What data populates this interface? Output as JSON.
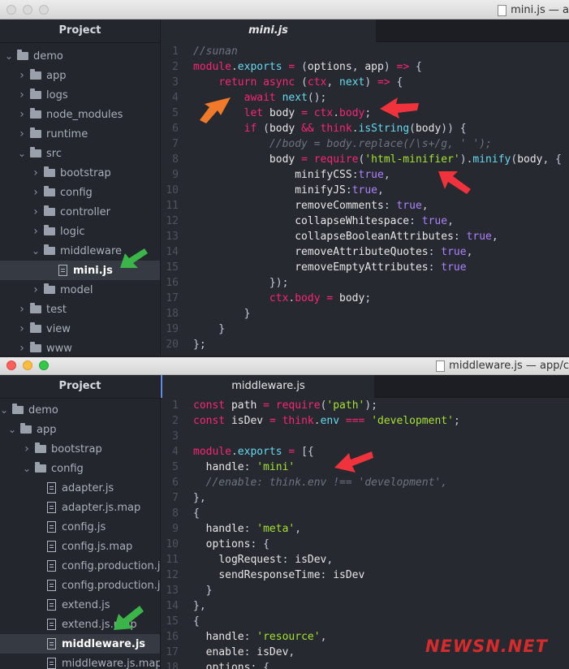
{
  "top_window": {
    "title": "mini.js — a",
    "sidebar_header": "Project",
    "tab_label": "mini.js",
    "tree": [
      {
        "label": "demo",
        "type": "folder",
        "expanded": true
      },
      {
        "label": "app",
        "type": "folder",
        "expanded": false
      },
      {
        "label": "logs",
        "type": "folder",
        "expanded": false
      },
      {
        "label": "node_modules",
        "type": "folder",
        "expanded": false
      },
      {
        "label": "runtime",
        "type": "folder",
        "expanded": false
      },
      {
        "label": "src",
        "type": "folder",
        "expanded": true
      },
      {
        "label": "bootstrap",
        "type": "folder",
        "expanded": false
      },
      {
        "label": "config",
        "type": "folder",
        "expanded": false
      },
      {
        "label": "controller",
        "type": "folder",
        "expanded": false
      },
      {
        "label": "logic",
        "type": "folder",
        "expanded": false
      },
      {
        "label": "middleware",
        "type": "folder",
        "expanded": true
      },
      {
        "label": "mini.js",
        "type": "file",
        "selected": true
      },
      {
        "label": "model",
        "type": "folder",
        "expanded": false
      },
      {
        "label": "test",
        "type": "folder",
        "expanded": false
      },
      {
        "label": "view",
        "type": "folder",
        "expanded": false
      },
      {
        "label": "www",
        "type": "folder",
        "expanded": false
      }
    ],
    "code_lines": [
      [
        "1",
        "//sunan"
      ],
      [
        "2",
        "module.exports = (options, app) => {"
      ],
      [
        "3",
        "    return async (ctx, next) => {"
      ],
      [
        "4",
        "        await next();"
      ],
      [
        "5",
        "        let body = ctx.body;"
      ],
      [
        "6",
        "        if (body && think.isString(body)) {"
      ],
      [
        "7",
        "            //body = body.replace(/\\s+/g, ' ');"
      ],
      [
        "8",
        "            body = require('html-minifier').minify(body, {"
      ],
      [
        "9",
        "                minifyCSS:true,"
      ],
      [
        "10",
        "                minifyJS:true,"
      ],
      [
        "11",
        "                removeComments: true,"
      ],
      [
        "12",
        "                collapseWhitespace: true,"
      ],
      [
        "13",
        "                collapseBooleanAttributes: true,"
      ],
      [
        "14",
        "                removeAttributeQuotes: true,"
      ],
      [
        "15",
        "                removeEmptyAttributes: true"
      ],
      [
        "16",
        "            });"
      ],
      [
        "17",
        "            ctx.body = body;"
      ],
      [
        "18",
        "        }"
      ],
      [
        "19",
        "    }"
      ],
      [
        "20",
        "};"
      ]
    ]
  },
  "bottom_window": {
    "title": "middleware.js — app/c",
    "sidebar_header": "Project",
    "tab_label": "middleware.js",
    "tree": [
      {
        "label": "demo",
        "type": "folder",
        "expanded": true
      },
      {
        "label": "app",
        "type": "folder",
        "expanded": true
      },
      {
        "label": "bootstrap",
        "type": "folder",
        "expanded": false
      },
      {
        "label": "config",
        "type": "folder",
        "expanded": true
      },
      {
        "label": "adapter.js",
        "type": "file"
      },
      {
        "label": "adapter.js.map",
        "type": "file"
      },
      {
        "label": "config.js",
        "type": "file"
      },
      {
        "label": "config.js.map",
        "type": "file"
      },
      {
        "label": "config.production.js",
        "type": "file"
      },
      {
        "label": "config.production.js.",
        "type": "file"
      },
      {
        "label": "extend.js",
        "type": "file"
      },
      {
        "label": "extend.js.map",
        "type": "file"
      },
      {
        "label": "middleware.js",
        "type": "file",
        "selected": true
      },
      {
        "label": "middleware.js.map",
        "type": "file"
      }
    ],
    "code_lines": [
      [
        "1",
        "const path = require('path');"
      ],
      [
        "2",
        "const isDev = think.env === 'development';"
      ],
      [
        "3",
        ""
      ],
      [
        "4",
        "module.exports = [{"
      ],
      [
        "5",
        "  handle: 'mini'"
      ],
      [
        "6",
        "  //enable: think.env !== 'development',"
      ],
      [
        "7",
        "},"
      ],
      [
        "8",
        "{"
      ],
      [
        "9",
        "  handle: 'meta',"
      ],
      [
        "10",
        "  options: {"
      ],
      [
        "11",
        "    logRequest: isDev,"
      ],
      [
        "12",
        "    sendResponseTime: isDev"
      ],
      [
        "13",
        "  }"
      ],
      [
        "14",
        "},"
      ],
      [
        "15",
        "{"
      ],
      [
        "16",
        "  handle: 'resource',"
      ],
      [
        "17",
        "  enable: isDev,"
      ],
      [
        "18",
        "  options: {"
      ]
    ]
  },
  "watermark": "NEWSN.NET",
  "colors": {
    "keyword": "#f92672",
    "function": "#66d9ef",
    "string": "#a6e22e",
    "boolean": "#ae81ff",
    "comment": "#6d7380",
    "red_arrow": "#f0323c",
    "orange_arrow": "#f07a2a",
    "green_arrow": "#3bb54a"
  }
}
